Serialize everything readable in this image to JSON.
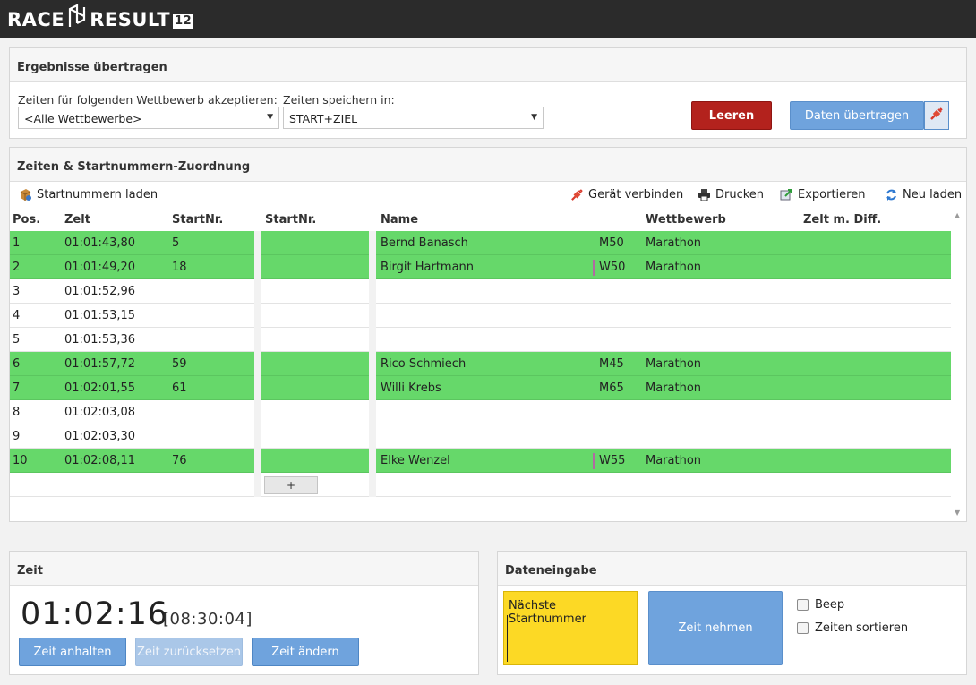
{
  "app": {
    "logo_left": "RACE",
    "logo_right": "RESULT",
    "version": "12"
  },
  "transfer_panel": {
    "title": "Ergebnisse übertragen",
    "accept_label": "Zeiten für folgenden Wettbewerb akzeptieren:",
    "accept_value": "<Alle Wettbewerbe>",
    "store_label": "Zeiten speichern in:",
    "store_value": "START+ZIEL",
    "clear_button": "Leeren",
    "transfer_button": "Daten übertragen"
  },
  "times_panel": {
    "title": "Zeiten & Startnummern-Zuordnung",
    "load_bibs": "Startnummern laden",
    "connect_device": "Gerät verbinden",
    "print": "Drucken",
    "export": "Exportieren",
    "reload": "Neu laden",
    "columns": {
      "pos": "Pos.",
      "time": "Zelt",
      "bib": "StartNr.",
      "bib_entry": "StartNr.",
      "name": "Name",
      "contest": "Wettbewerb",
      "diff": "Zelt m. Diff."
    },
    "rows": [
      {
        "pos": "1",
        "time": "01:01:43,80",
        "bib": "5",
        "name": "Bernd Banasch",
        "ag": "M50",
        "contest": "Marathon",
        "green": true,
        "marker": false
      },
      {
        "pos": "2",
        "time": "01:01:49,20",
        "bib": "18",
        "name": "Birgit Hartmann",
        "ag": "W50",
        "contest": "Marathon",
        "green": true,
        "marker": true
      },
      {
        "pos": "3",
        "time": "01:01:52,96",
        "bib": "",
        "name": "",
        "ag": "",
        "contest": "",
        "green": false,
        "marker": false
      },
      {
        "pos": "4",
        "time": "01:01:53,15",
        "bib": "",
        "name": "",
        "ag": "",
        "contest": "",
        "green": false,
        "marker": false
      },
      {
        "pos": "5",
        "time": "01:01:53,36",
        "bib": "",
        "name": "",
        "ag": "",
        "contest": "",
        "green": false,
        "marker": false
      },
      {
        "pos": "6",
        "time": "01:01:57,72",
        "bib": "59",
        "name": "Rico Schmiech",
        "ag": "M45",
        "contest": "Marathon",
        "green": true,
        "marker": false
      },
      {
        "pos": "7",
        "time": "01:02:01,55",
        "bib": "61",
        "name": "Willi Krebs",
        "ag": "M65",
        "contest": "Marathon",
        "green": true,
        "marker": false
      },
      {
        "pos": "8",
        "time": "01:02:03,08",
        "bib": "",
        "name": "",
        "ag": "",
        "contest": "",
        "green": false,
        "marker": false
      },
      {
        "pos": "9",
        "time": "01:02:03,30",
        "bib": "",
        "name": "",
        "ag": "",
        "contest": "",
        "green": false,
        "marker": false
      },
      {
        "pos": "10",
        "time": "01:02:08,11",
        "bib": "76",
        "name": "Elke Wenzel",
        "ag": "W55",
        "contest": "Marathon",
        "green": true,
        "marker": true
      }
    ],
    "add_row": "+"
  },
  "time_panel": {
    "title": "Zeit",
    "current": "01:02:16",
    "secondary": "[08:30:04]",
    "stop_button": "Zeit anhalten",
    "reset_button": "Zeit zurücksetzen",
    "change_button": "Zeit ändern"
  },
  "entry_panel": {
    "title": "Dateneingabe",
    "next_bib": "Nächste Startnummer",
    "take_time_button": "Zeit nehmen",
    "beep": "Beep",
    "sort_times": "Zeiten sortieren"
  },
  "colors": {
    "green_row": "#66d86a",
    "red_button": "#b3221d",
    "blue_button": "#6fa3dd",
    "yellow_input": "#fcd925"
  },
  "icons": [
    "logo-mark-icon",
    "plug-icon",
    "load-bibs-icon",
    "print-icon",
    "export-icon",
    "reload-icon",
    "chevron-down-icon",
    "scroll-up-icon",
    "scroll-down-icon"
  ]
}
